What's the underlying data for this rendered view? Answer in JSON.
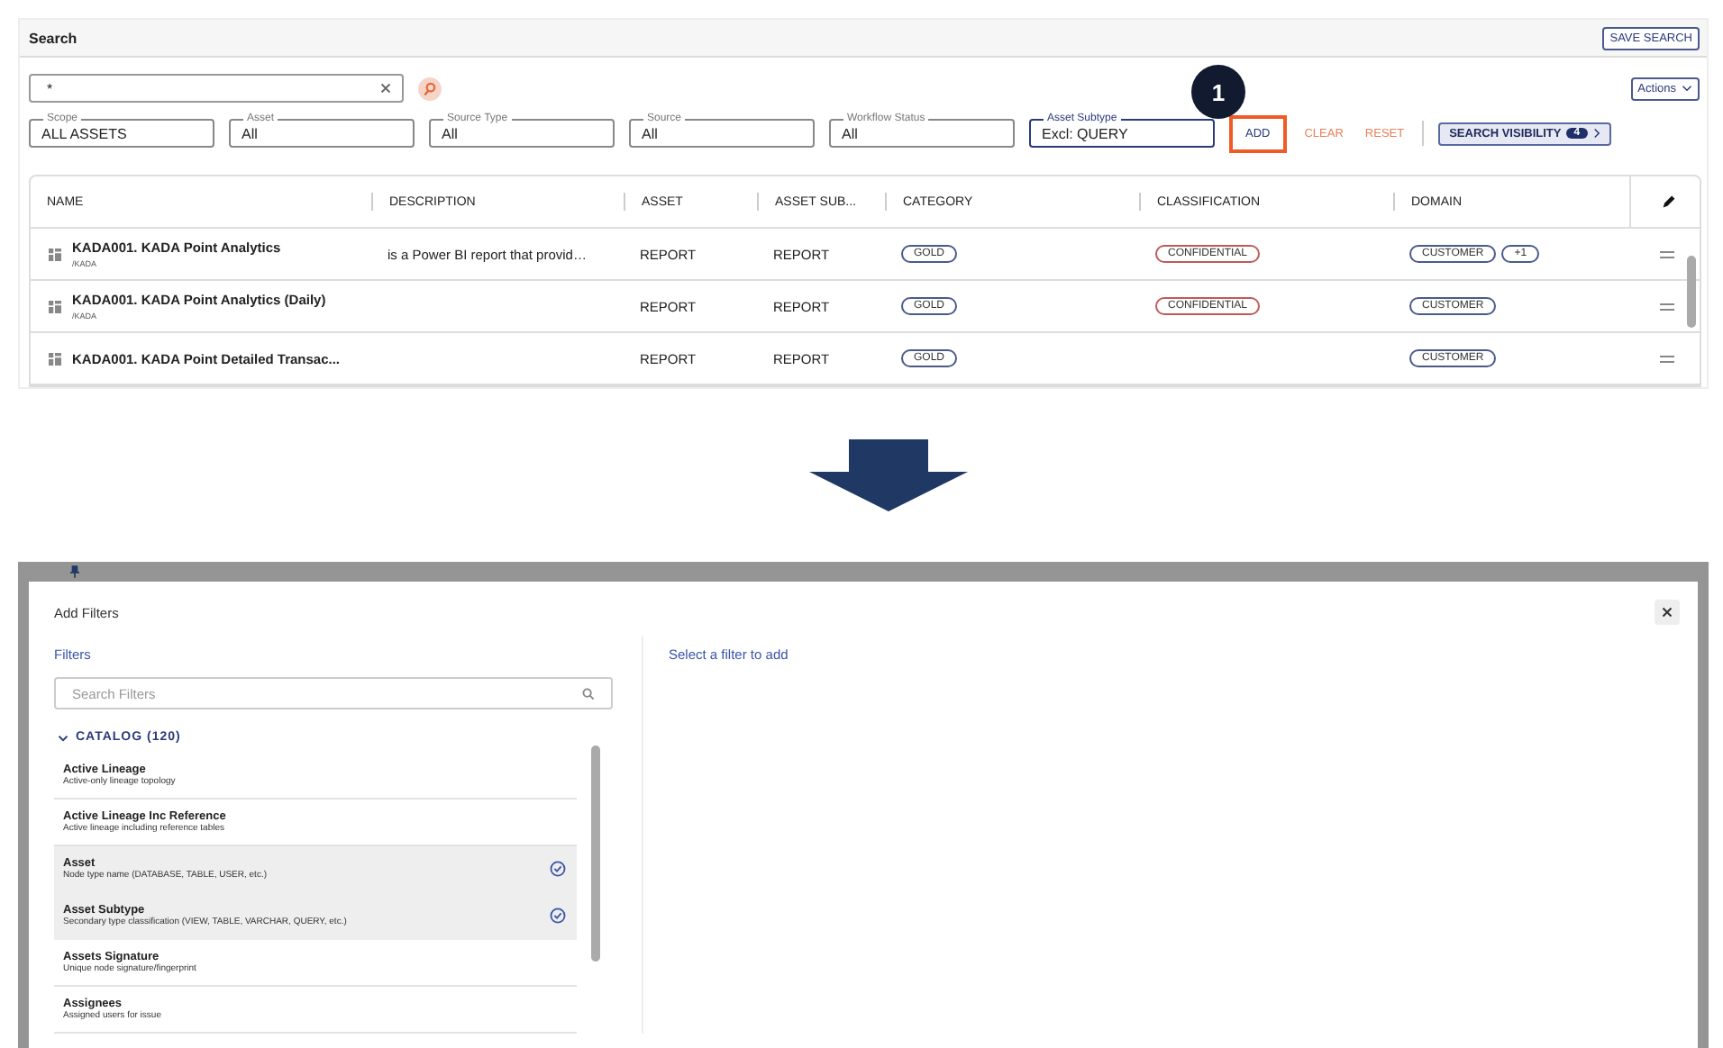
{
  "search_page": {
    "title": "Search",
    "save_button": "SAVE SEARCH",
    "search_field": {
      "value": "*"
    },
    "actions_button": "Actions",
    "filters": [
      {
        "label": "Scope",
        "value": "ALL ASSETS",
        "active": false
      },
      {
        "label": "Asset",
        "value": "All",
        "active": false
      },
      {
        "label": "Source Type",
        "value": "All",
        "active": false
      },
      {
        "label": "Source",
        "value": "All",
        "active": false
      },
      {
        "label": "Workflow Status",
        "value": "All",
        "active": false
      },
      {
        "label": "Asset Subtype",
        "value": "Excl: QUERY",
        "active": true
      }
    ],
    "step_badge": "1",
    "add_button": "ADD",
    "clear_button": "CLEAR",
    "reset_button": "RESET",
    "visibility_button": {
      "label": "SEARCH VISIBILITY",
      "count": "4"
    },
    "table": {
      "columns": [
        "NAME",
        "DESCRIPTION",
        "ASSET",
        "ASSET SUB...",
        "CATEGORY",
        "CLASSIFICATION",
        "DOMAIN"
      ],
      "rows": [
        {
          "name": "KADA001. KADA Point Analytics",
          "path": "/KADA",
          "description": "is a Power BI report that provid…",
          "asset": "REPORT",
          "asset_subtype": "REPORT",
          "category": [
            "GOLD"
          ],
          "classification": [
            "CONFIDENTIAL"
          ],
          "domain": [
            "CUSTOMER",
            "+1"
          ]
        },
        {
          "name": "KADA001. KADA Point Analytics (Daily)",
          "path": "/KADA",
          "description": "",
          "asset": "REPORT",
          "asset_subtype": "REPORT",
          "category": [
            "GOLD"
          ],
          "classification": [
            "CONFIDENTIAL"
          ],
          "domain": [
            "CUSTOMER"
          ]
        },
        {
          "name": "KADA001. KADA Point Detailed Transac...",
          "path": "",
          "description": "",
          "asset": "REPORT",
          "asset_subtype": "REPORT",
          "category": [
            "GOLD"
          ],
          "classification": [],
          "domain": [
            "CUSTOMER"
          ]
        }
      ]
    }
  },
  "add_filters_dialog": {
    "title": "Add Filters",
    "filters_label": "Filters",
    "search": {
      "placeholder": "Search Filters"
    },
    "group": {
      "label": "CATALOG (120)",
      "expanded": true
    },
    "items": [
      {
        "name": "Active Lineage",
        "description": "Active-only lineage topology",
        "selected": false
      },
      {
        "name": "Active Lineage Inc Reference",
        "description": "Active lineage including reference tables",
        "selected": false
      },
      {
        "name": "Asset",
        "description": "Node type name (DATABASE, TABLE, USER, etc.)",
        "selected": true
      },
      {
        "name": "Asset Subtype",
        "description": "Secondary type classification (VIEW, TABLE, VARCHAR, QUERY, etc.)",
        "selected": true
      },
      {
        "name": "Assets Signature",
        "description": "Unique node signature/fingerprint",
        "selected": false
      },
      {
        "name": "Assignees",
        "description": "Assigned users for issue",
        "selected": false
      }
    ],
    "hint": "Select a filter to add"
  }
}
